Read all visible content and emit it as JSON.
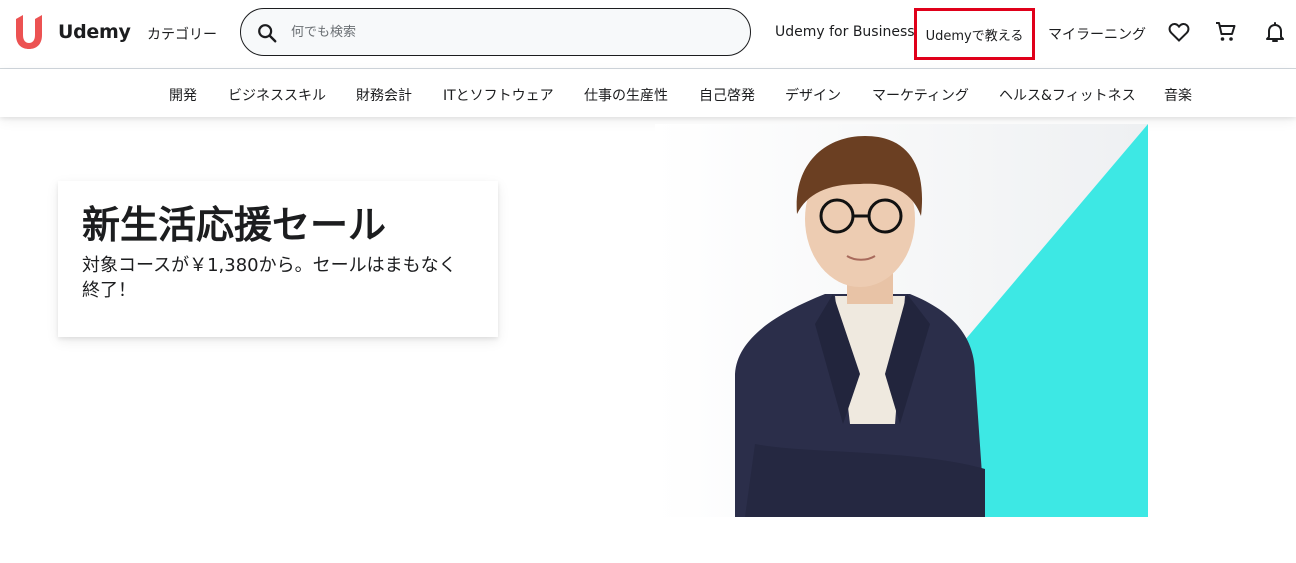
{
  "header": {
    "logo_text": "Udemy",
    "categories_label": "カテゴリー",
    "search": {
      "placeholder": "何でも検索",
      "value": ""
    },
    "nav": {
      "business": "Udemy for Business",
      "teach": "Udemyで教える",
      "my_learning": "マイラーニング"
    },
    "icons": [
      "heart-icon",
      "cart-icon",
      "bell-icon"
    ],
    "highlight_color": "#e0001a",
    "brand_color": "#ec5252"
  },
  "category_bar": {
    "items": [
      "開発",
      "ビジネススキル",
      "財務会計",
      "ITとソフトウェア",
      "仕事の生産性",
      "自己啓発",
      "デザイン",
      "マーケティング",
      "ヘルス&フィットネス",
      "音楽"
    ]
  },
  "hero": {
    "title": "新生活応援セール",
    "subtitle": "対象コースが￥1,380から。セールはまもなく終了！",
    "accent_color": "#3de8e4"
  }
}
